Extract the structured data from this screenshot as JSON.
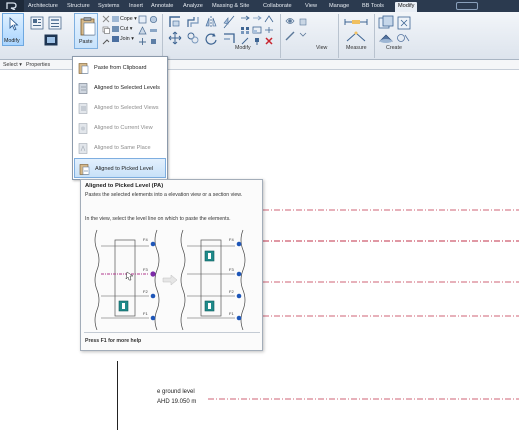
{
  "tabs": [
    {
      "label": "Architecture",
      "active": false
    },
    {
      "label": "Structure",
      "active": false
    },
    {
      "label": "Systems",
      "active": false
    },
    {
      "label": "Insert",
      "active": false
    },
    {
      "label": "Annotate",
      "active": false
    },
    {
      "label": "Analyze",
      "active": false
    },
    {
      "label": "Massing & Site",
      "active": false
    },
    {
      "label": "Collaborate",
      "active": false
    },
    {
      "label": "View",
      "active": false
    },
    {
      "label": "Manage",
      "active": false
    },
    {
      "label": "BB Tools",
      "active": false
    },
    {
      "label": "Modify",
      "active": true
    }
  ],
  "ribbon": {
    "modify_label": "Modify",
    "paste_label": "Paste",
    "cope_label": "Cope",
    "cut_label": "Cut",
    "join_label": "Join",
    "panels": {
      "modify": "Modify",
      "view": "View",
      "measure": "Measure",
      "create": "Create"
    }
  },
  "strip": {
    "select": "Select ▾",
    "properties": "Properties"
  },
  "paste_menu": {
    "items": [
      {
        "label": "Paste from Clipboard",
        "state": "normal"
      },
      {
        "label": "Aligned to Selected Levels",
        "state": "normal"
      },
      {
        "label": "Aligned to Selected Views",
        "state": "disabled"
      },
      {
        "label": "Aligned to Current View",
        "state": "disabled"
      },
      {
        "label": "Aligned to Same Place",
        "state": "disabled"
      },
      {
        "label": "Aligned to Picked Level",
        "state": "selected"
      }
    ]
  },
  "tooltip": {
    "title": "Aligned to Picked Level (PA)",
    "description": "Pastes the selected elements into a elevation view or a section view.",
    "instruction": "In the view, select the level line on which to paste the elements.",
    "help": "Press F1 for more help",
    "figure_labels": [
      "F4",
      "F3",
      "F2",
      "F1",
      "F4",
      "F3",
      "F2",
      "F1"
    ]
  },
  "canvas": {
    "level_name": "e ground level",
    "level_elevation": "AHD 19.050 m"
  },
  "colors": {
    "tabbar_bg": "#2b3a4f",
    "level_line": "#c0304a",
    "highlight": "#c8e1f8"
  }
}
